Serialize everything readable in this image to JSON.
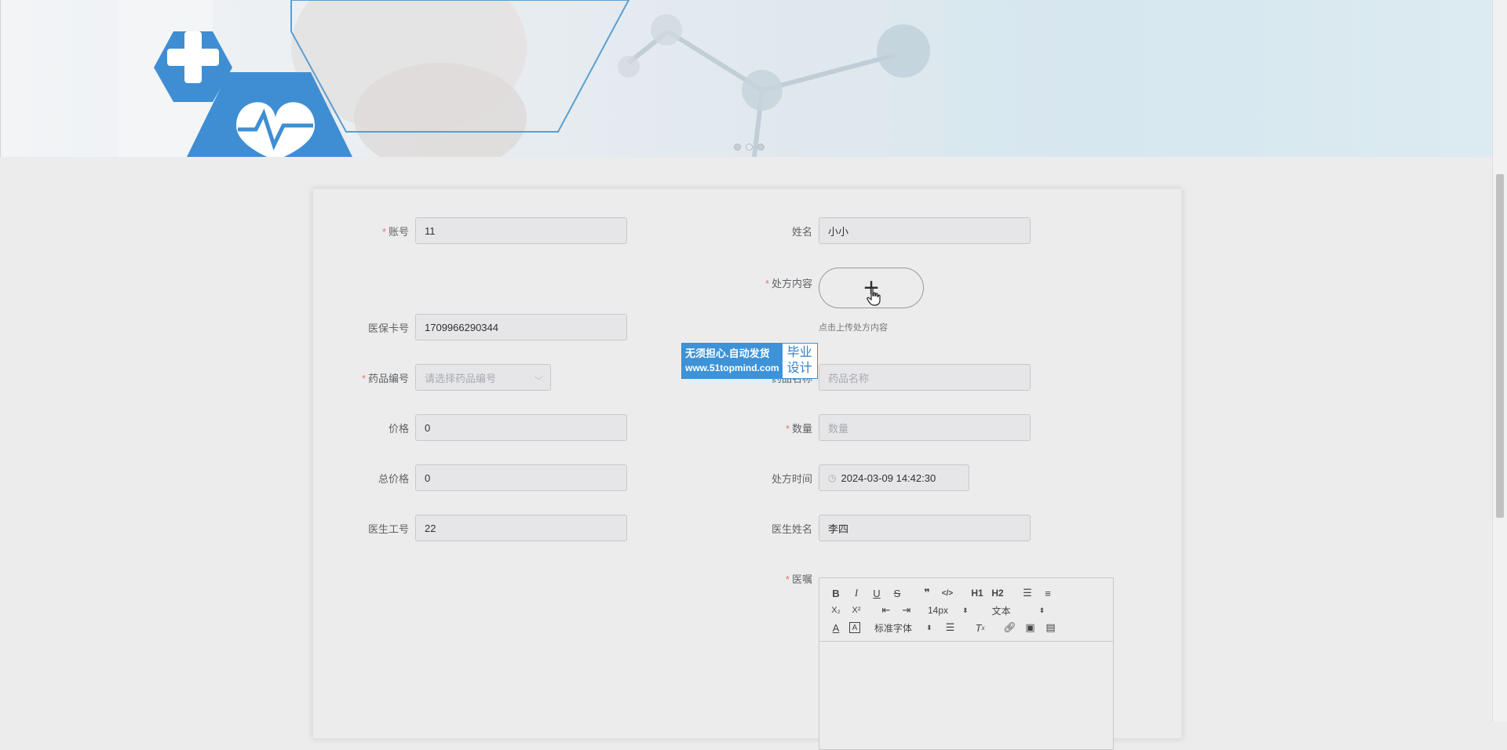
{
  "carousel": {
    "slide_count": 3,
    "active_index": 1
  },
  "form": {
    "account": {
      "label": "账号",
      "value": "11",
      "required": true
    },
    "name": {
      "label": "姓名",
      "value": "小小",
      "required": false
    },
    "prescription_content": {
      "label": "处方内容",
      "required": true,
      "upload_hint": "点击上传处方内容"
    },
    "insurance_card": {
      "label": "医保卡号",
      "value": "1709966290344",
      "required": false
    },
    "drug_code": {
      "label": "药品编号",
      "placeholder": "请选择药品编号",
      "required": true
    },
    "drug_name": {
      "label": "药品名称",
      "placeholder": "药品名称",
      "required": false
    },
    "price": {
      "label": "价格",
      "value": "0",
      "required": false
    },
    "quantity": {
      "label": "数量",
      "placeholder": "数量",
      "required": true
    },
    "total_price": {
      "label": "总价格",
      "value": "0",
      "required": false
    },
    "prescription_time": {
      "label": "处方时间",
      "value": "2024-03-09 14:42:30",
      "required": false
    },
    "doctor_id": {
      "label": "医生工号",
      "value": "22",
      "required": false
    },
    "doctor_name": {
      "label": "医生姓名",
      "value": "李四",
      "required": false
    },
    "advice": {
      "label": "医嘱",
      "required": true
    }
  },
  "editor": {
    "font_size": "14px",
    "header_select": "文本",
    "font_family": "标准字体",
    "buttons": {
      "bold": "B",
      "italic": "I",
      "underline": "U",
      "strike": "S",
      "blockquote": "❞",
      "code": "</>",
      "h1": "H1",
      "h2": "H2",
      "sub": "X₂",
      "sup": "X²"
    }
  },
  "watermark": {
    "line1": "无须担心.自动发货",
    "line2": "www.51topmind.com",
    "tag1": "毕业",
    "tag2": "设计"
  },
  "colors": {
    "required_star": "#f56c6c",
    "watermark_blue": "#3d92d8",
    "hex_blue": "#3f8ed3"
  }
}
